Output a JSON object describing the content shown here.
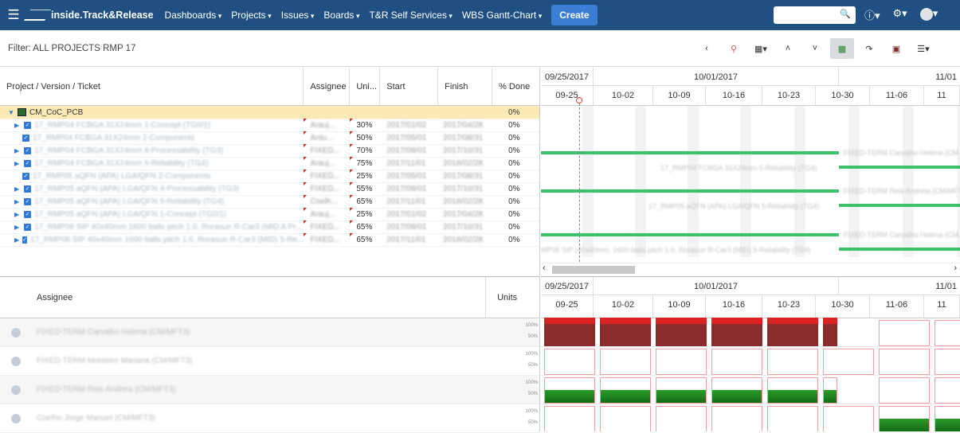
{
  "topbar": {
    "logo": "inside.Track&Release",
    "nav": [
      "Dashboards",
      "Projects",
      "Issues",
      "Boards",
      "T&R Self Services",
      "WBS Gantt-Chart"
    ],
    "create": "Create",
    "help": "?",
    "settings": "⚙"
  },
  "filter": {
    "label": "Filter: ALL PROJECTS RMP 17"
  },
  "grid": {
    "headers": {
      "project": "Project / Version / Ticket",
      "assignee": "Assignee",
      "units": "Uni...",
      "start": "Start",
      "finish": "Finish",
      "done": "% Done"
    },
    "root": {
      "name": "CM_CoC_PCB",
      "done": "0%"
    },
    "rows": [
      {
        "name": "17_RMP04 FCBGA 31X24mm 1-Concept (TG0/1)",
        "assignee": "Arauj...",
        "units": "30%",
        "start": "2017/01/02",
        "finish": "2017/04/28",
        "done": "0%"
      },
      {
        "name": "17_RMP04 FCBGA 31X24mm 2-Components",
        "assignee": "Antu...",
        "units": "50%",
        "start": "2017/05/01",
        "finish": "2017/08/31",
        "done": "0%"
      },
      {
        "name": "17_RMP04 FCBGA 31X24mm 4-Processability (TG3)",
        "assignee": "FIXED...",
        "units": "70%",
        "start": "2017/09/01",
        "finish": "2017/10/31",
        "done": "0%"
      },
      {
        "name": "17_RMP04 FCBGA 31X24mm 5-Reliability (TG4)",
        "assignee": "Arauj...",
        "units": "75%",
        "start": "2017/11/01",
        "finish": "2018/02/28",
        "done": "0%"
      },
      {
        "name": "17_RMP05 aQFN (APA) LGA/QFN 2-Components",
        "assignee": "FIXED...",
        "units": "25%",
        "start": "2017/05/01",
        "finish": "2017/08/31",
        "done": "0%"
      },
      {
        "name": "17_RMP05 aQFN (APA) LGA/QFN 4-Processability (TG3)",
        "assignee": "FIXED...",
        "units": "55%",
        "start": "2017/09/01",
        "finish": "2017/10/31",
        "done": "0%"
      },
      {
        "name": "17_RMP05 aQFN (APA) LGA/QFN 5-Reliability (TG4)",
        "assignee": "Coelh...",
        "units": "65%",
        "start": "2017/11/01",
        "finish": "2018/02/28",
        "done": "0%"
      },
      {
        "name": "17_RMP05 aQFN (APA) LGA/QFN 1-Concept (TG0/1)",
        "assignee": "Arauj...",
        "units": "25%",
        "start": "2017/01/02",
        "finish": "2017/04/28",
        "done": "0%"
      },
      {
        "name": "17_RMP06 SIP 40x40mm 1600 balls pitch 1.0, Rorasun R-Car3 (MID A Pr...",
        "assignee": "FIXED...",
        "units": "65%",
        "start": "2017/09/01",
        "finish": "2017/10/31",
        "done": "0%"
      },
      {
        "name": "17_RMP06 SIP 40x40mm 1600 balls pitch 1.0, Rorasun R-Car3 (MID) 5-Re...",
        "assignee": "FIXED...",
        "units": "65%",
        "start": "2017/11/01",
        "finish": "2018/02/28",
        "done": "0%"
      }
    ]
  },
  "gantt": {
    "months": [
      "09/25/2017",
      "10/01/2017",
      "11/01"
    ],
    "weeks": [
      "09-25",
      "10-02",
      "10-09",
      "10-16",
      "10-23",
      "10-30",
      "11-06",
      "11"
    ],
    "bar_labels": [
      "FIXED-TERM Carvalho Helena (CM",
      "17_RMP04 FCBGA 31X24mm 5-Reliability (TG4)",
      "FIXED-TERM Reis Andreia (CM/MFT3",
      "17_RMP05 aQFN (APA) LGA/QFN 5-Reliability (TG4)",
      "FIXED-TERM Carvalho Helena (CM",
      "MP06 SIP (40x40mm, 1600 balls pitch 1.0, Rorasun R-Car3 (MID) 5-Reliability (TG4)"
    ]
  },
  "resources": {
    "headers": {
      "assignee": "Assignee",
      "units": "Units"
    },
    "rows": [
      {
        "name": "FIXED-TERM Carvalho Helena (CM/MFT3)"
      },
      {
        "name": "FIXED-TERM Monteiro Mariana (CM/MFT3)"
      },
      {
        "name": "FIXED-TERM Reis Andreia (CM/MFT3)"
      },
      {
        "name": "Coelho Jorge Manuel (CM/MFT3)"
      }
    ],
    "scale": {
      "top": "100%",
      "mid": "50%"
    }
  },
  "colors": {
    "topbar": "#205081",
    "bar": "#3cc26b",
    "over": "#dd2020",
    "ok": "#1f8a1f"
  }
}
